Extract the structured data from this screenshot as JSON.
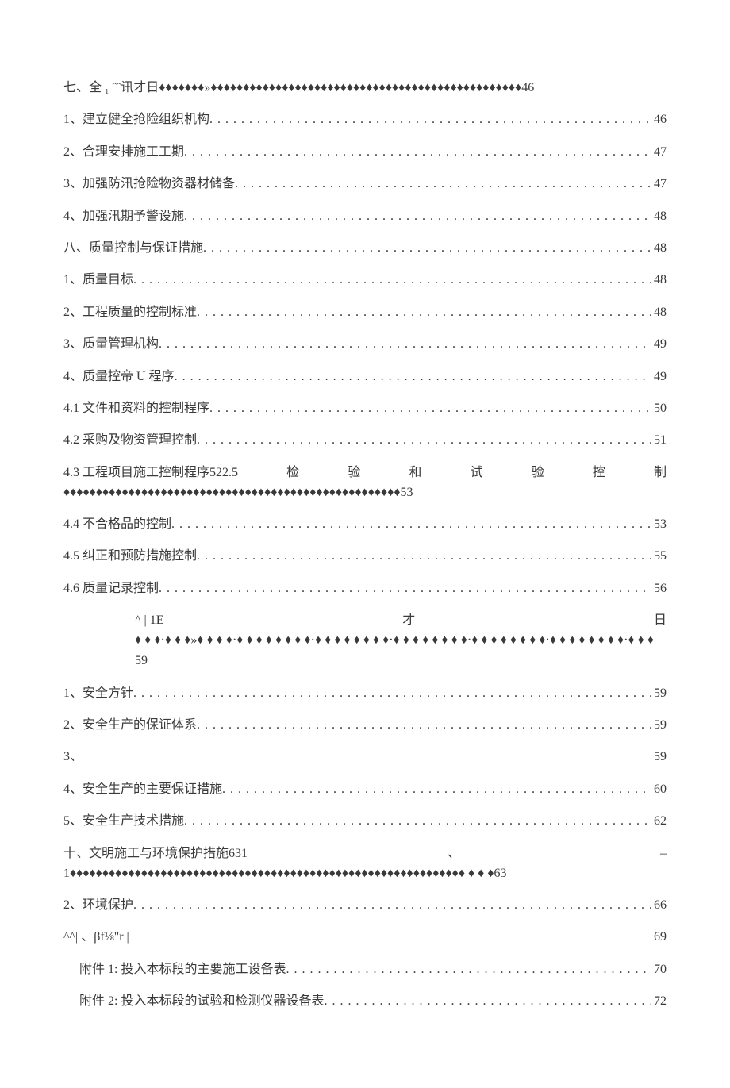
{
  "entries": [
    {
      "type": "freeform",
      "text": "七、全 ₁ ˆˆ讯才日♦♦♦♦♦♦♦»♦♦♦♦♦♦♦♦♦♦♦♦♦♦♦♦♦♦♦♦♦♦♦♦♦♦♦♦♦♦♦♦♦♦♦♦♦♦♦♦♦♦♦♦♦♦♦♦46"
    },
    {
      "type": "dotted",
      "label": "1、建立健全抢险组织机构",
      "page": "46"
    },
    {
      "type": "dotted",
      "label": "2、合理安排施工工期",
      "page": "47"
    },
    {
      "type": "dotted",
      "label": "3、加强防汛抢险物资器材储备",
      "page": "47"
    },
    {
      "type": "dotted",
      "label": "4、加强汛期予警设施",
      "page": "48"
    },
    {
      "type": "dotted",
      "label": "八、质量控制与保证措施",
      "page": "48"
    },
    {
      "type": "dotted",
      "label": "1、质量目标",
      "page": "48"
    },
    {
      "type": "dotted",
      "label": "2、工程质量的控制标准",
      "page": "48"
    },
    {
      "type": "dotted",
      "label": "3、质量管理机构",
      "page": "49"
    },
    {
      "type": "dotted",
      "label": "4、质量控帝 U 程序",
      "page": "49"
    },
    {
      "type": "dotted",
      "label": "4.1 文件和资料的控制程序",
      "page": "50"
    },
    {
      "type": "dotted",
      "label": "4.2 采购及物资管理控制",
      "page": "51"
    },
    {
      "type": "block43",
      "line1": [
        "4.3 工程项目施工控制程序522.5",
        "检",
        "验",
        "和",
        "试",
        "验",
        "控",
        "制"
      ],
      "line2": "♦♦♦♦♦♦♦♦♦♦♦♦♦♦♦♦♦♦♦♦♦♦♦♦♦♦♦♦♦♦♦♦♦♦♦♦♦♦♦♦♦♦♦♦♦♦♦♦♦♦♦♦53"
    },
    {
      "type": "dotted",
      "label": "4.4 不合格品的控制",
      "page": "53"
    },
    {
      "type": "dotted",
      "label": "4.5 纠正和预防措施控制",
      "page": "55"
    },
    {
      "type": "dotted",
      "label": "4.6 质量记录控制",
      "page": "56"
    },
    {
      "type": "block9",
      "line1": [
        "^ | 1E",
        "才",
        "日"
      ],
      "line2": "♦ ♦ ♦·♦ ♦ ♦»♦ ♦ ♦ ♦·♦ ♦ ♦ ♦ ♦ ♦ ♦ ♦·♦ ♦ ♦ ♦ ♦ ♦ ♦ ♦·♦ ♦ ♦ ♦ ♦ ♦ ♦ ♦·♦ ♦ ♦ ♦ ♦ ♦ ♦ ♦·♦ ♦ ♦ ♦ ♦ ♦ ♦ ♦·♦ ♦ ♦",
      "line3": "59"
    },
    {
      "type": "dotted",
      "label": "1、安全方针",
      "page": "59"
    },
    {
      "type": "dotted",
      "label": "2、安全生产的保证体系",
      "page": "59"
    },
    {
      "type": "sparse",
      "left": "3、",
      "right": "59"
    },
    {
      "type": "dotted",
      "label": "4、安全生产的主要保证措施",
      "page": "60"
    },
    {
      "type": "dotted",
      "label": "5、安全生产技术措施",
      "page": "62"
    },
    {
      "type": "block10",
      "line1": [
        "十、文明施工与环境保护措施631",
        "、",
        "–"
      ],
      "line2": "1♦♦♦♦♦♦♦♦♦♦♦♦♦♦♦♦♦♦♦♦♦♦♦♦♦♦♦♦♦♦♦♦♦♦♦♦♦♦♦♦♦♦♦♦♦♦♦♦♦♦♦♦♦♦♦♦♦♦♦♦♦ ♦ ♦ ♦63"
    },
    {
      "type": "dotted",
      "label": "2、环境保护",
      "page": "66"
    },
    {
      "type": "sparse",
      "left": "^^| 、βf⅛\"r |",
      "right": "69"
    },
    {
      "type": "dotted",
      "indent": true,
      "label": "附件 1:     投入本标段的主要施工设备表",
      "page": "70"
    },
    {
      "type": "dotted",
      "indent": true,
      "label": "附件 2:     投入本标段的试验和检测仪器设备表",
      "page": "72"
    }
  ],
  "leader_dots": ". . . . . . . . . . . . . . . . . . . . . . . . . . . . . . . . . . . . . . . . . . . . . . . . . . . . . . . . . . . . . . . . . . . . . . . . . . . . . . . . . . . . . . . . . . . . . . . . . . . . . . . . . . . . . . . . . . . . . . . . "
}
